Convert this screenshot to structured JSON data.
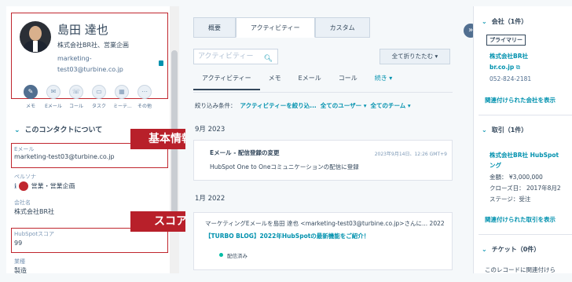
{
  "contact": {
    "name": "島田 達也",
    "company": "株式会社BR社、営業企画",
    "email_line1": "marketing-",
    "email_line2": "test03@turbine.co.jp"
  },
  "actions": [
    {
      "label": "メモ",
      "icon": "note-icon"
    },
    {
      "label": "Eメール",
      "icon": "email-icon"
    },
    {
      "label": "コール",
      "icon": "phone-icon"
    },
    {
      "label": "タスク",
      "icon": "task-icon"
    },
    {
      "label": "ミーテ...",
      "icon": "meeting-icon"
    },
    {
      "label": "その他",
      "icon": "more-icon"
    }
  ],
  "about": {
    "heading": "このコンタクトについて",
    "email_label": "Eメール",
    "email_value": "marketing-test03@turbine.co.jp",
    "persona_label": "ペルソナ",
    "persona_value": "営業・営業企画",
    "company_label": "会社名",
    "company_value": "株式会社BR社",
    "score_label": "HubSpotスコア",
    "score_value": "99",
    "industry_label": "業種",
    "industry_value": "製造"
  },
  "annotations": {
    "basic_info": "基本情報",
    "score": "スコア"
  },
  "middle": {
    "tabs": [
      "概要",
      "アクティビティー",
      "カスタム"
    ],
    "search_placeholder": "アクティビティー",
    "collapse_all": "全て折りたたむ ▾",
    "subtabs": [
      "アクティビティー",
      "メモ",
      "Eメール",
      "コール",
      "続き ▾"
    ],
    "filter_label": "絞り込み条件：",
    "filter_activity": "アクティビティーを絞り込...",
    "filter_users": "全てのユーザー ▾",
    "filter_teams": "全てのチーム ▾",
    "month1": "9月 2023",
    "card1_title": "Eメール - 配信登録の変更",
    "card1_date": "2023年9月14日、12:26 GMT+9",
    "card1_body": "HubSpot One to Oneコミュニケーションの配信に登録",
    "month2": "1月 2022",
    "card2_title": "マーケティングEメールを島田 達也 <marketing-test03@turbine.co.jp>さんに... 2022",
    "card2_link": "【TURBO BLOG】2022年HubSpotの最新機能をご紹介！",
    "card2_status": "配信済み"
  },
  "right": {
    "company_section": "会社（1件）",
    "primary": "プライマリー",
    "company_name": "株式会社BR社",
    "company_domain": "br.co.jp",
    "company_phone": "052-824-2181",
    "company_link": "関連付けられた会社を表示",
    "deals_section": "取引（1件）",
    "deal_name1": "株式会社BR社 HubSpot",
    "deal_name2": "ング",
    "deal_amount": "金額： ¥3,000,000",
    "deal_close": "クローズ日： 2017年8月2",
    "deal_stage": "ステージ：受注",
    "deals_link": "関連付けられた取引を表示",
    "tickets_section": "チケット（0件）",
    "tickets_text": "このレコードに関連付けら"
  }
}
